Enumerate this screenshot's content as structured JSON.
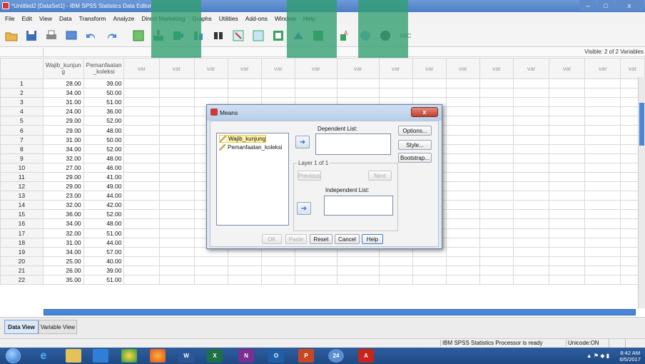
{
  "window": {
    "title": "*Untitled2 [DataSet1] - IBM SPSS Statistics Data Editor",
    "minimize": "–",
    "maximize": "□",
    "close": "x"
  },
  "menu": [
    "File",
    "Edit",
    "View",
    "Data",
    "Transform",
    "Analyze",
    "Direct Marketing",
    "Graphs",
    "Utilities",
    "Add-ons",
    "Window",
    "Help"
  ],
  "strip": {
    "visible": "Visible: 2 of 2 Variables"
  },
  "columns": {
    "col1": "Wajib_kunjun g",
    "col2": "Pemanfaatan _koleksi",
    "var": "var"
  },
  "rows": [
    {
      "n": "1",
      "a": "28.00",
      "b": "39.00"
    },
    {
      "n": "2",
      "a": "34.00",
      "b": "50.00"
    },
    {
      "n": "3",
      "a": "31.00",
      "b": "51.00"
    },
    {
      "n": "4",
      "a": "24.00",
      "b": "36.00"
    },
    {
      "n": "5",
      "a": "29.00",
      "b": "52.00"
    },
    {
      "n": "6",
      "a": "29.00",
      "b": "48.00"
    },
    {
      "n": "7",
      "a": "31.00",
      "b": "50.00"
    },
    {
      "n": "8",
      "a": "34.00",
      "b": "52.00"
    },
    {
      "n": "9",
      "a": "32.00",
      "b": "48.00"
    },
    {
      "n": "10",
      "a": "27.00",
      "b": "46.00"
    },
    {
      "n": "11",
      "a": "29.00",
      "b": "41.00"
    },
    {
      "n": "12",
      "a": "29.00",
      "b": "49.00"
    },
    {
      "n": "13",
      "a": "23.00",
      "b": "44.00"
    },
    {
      "n": "14",
      "a": "32.00",
      "b": "42.00"
    },
    {
      "n": "15",
      "a": "36.00",
      "b": "52.00"
    },
    {
      "n": "16",
      "a": "34.00",
      "b": "48.00"
    },
    {
      "n": "17",
      "a": "32.00",
      "b": "51.00"
    },
    {
      "n": "18",
      "a": "31.00",
      "b": "44.00"
    },
    {
      "n": "19",
      "a": "34.00",
      "b": "57.00"
    },
    {
      "n": "20",
      "a": "25.00",
      "b": "40.00"
    },
    {
      "n": "21",
      "a": "26.00",
      "b": "39.00"
    },
    {
      "n": "22",
      "a": "35.00",
      "b": "51.00"
    }
  ],
  "tabs": {
    "data_view": "Data View",
    "variable_view": "Variable View"
  },
  "status": {
    "processor": "IBM SPSS Statistics Processor is ready",
    "unicode": "Unicode:ON"
  },
  "taskbar": {
    "time": "8:42 AM",
    "date": "6/5/2017"
  },
  "dialog": {
    "title": "Means",
    "close": "x",
    "variables": [
      "Wajib_kunjung",
      "Pemanfaatan_koleksi"
    ],
    "dependent_label": "Dependent List:",
    "layer_label": "Layer 1 of 1",
    "previous": "Previous",
    "next": "Next",
    "independent_label": "Independent List:",
    "options": "Options...",
    "style": "Style...",
    "bootstrap": "Bootstrap...",
    "ok": "OK",
    "paste": "Paste",
    "reset": "Reset",
    "cancel": "Cancel",
    "help": "Help"
  },
  "colors": {
    "accent": "#4a86d8",
    "watermark": "#2f9e6e"
  }
}
